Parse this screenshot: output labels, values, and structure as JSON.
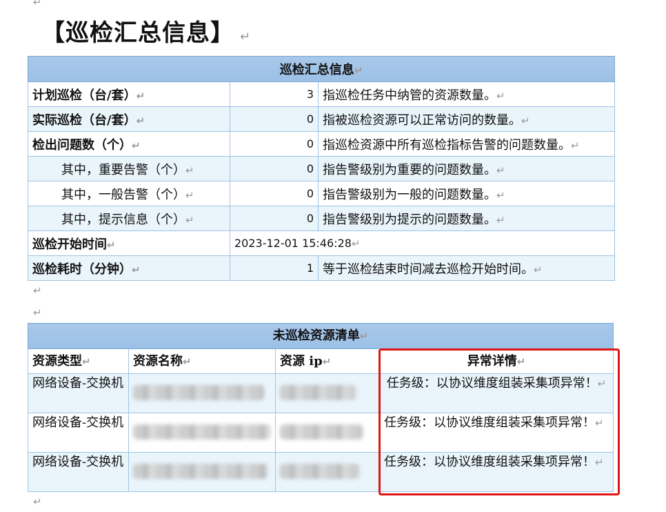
{
  "mark": "↵",
  "title": "【巡检汇总信息】",
  "summary": {
    "header": "巡检汇总信息",
    "rows": [
      {
        "label": "计划巡检（台/套）",
        "value": "3",
        "desc": "指巡检任务中纳管的资源数量。"
      },
      {
        "label": "实际巡检（台/套）",
        "value": "0",
        "desc": "指被巡检资源可以正常访问的数量。"
      },
      {
        "label": "检出问题数（个）",
        "value": "0",
        "desc": "指巡检资源中所有巡检指标告警的问题数量。"
      },
      {
        "label": "其中，重要告警（个）",
        "value": "0",
        "desc": "指告警级别为重要的问题数量。"
      },
      {
        "label": "其中，一般告警（个）",
        "value": "0",
        "desc": "指告警级别为一般的问题数量。"
      },
      {
        "label": "其中，提示信息（个）",
        "value": "0",
        "desc": "指告警级别为提示的问题数量。"
      },
      {
        "label": "巡检开始时间",
        "value": "2023-12-01 15:46:28",
        "desc": ""
      },
      {
        "label": "巡检耗时（分钟）",
        "value": "1",
        "desc": "等于巡检结束时间减去巡检开始时间。"
      }
    ]
  },
  "unchecked": {
    "header": "未巡检资源清单",
    "columns": [
      "资源类型",
      "资源名称",
      "资源 ip",
      "异常详情"
    ],
    "rows": [
      {
        "type": "网络设备-交换机",
        "detail": "任务级：以协议维度组装采集项异常！"
      },
      {
        "type": "网络设备-交换机",
        "detail": "任务级：以协议维度组装采集项异常！"
      },
      {
        "type": "网络设备-交换机",
        "detail": "任务级：以协议维度组装采集项异常！"
      }
    ]
  }
}
